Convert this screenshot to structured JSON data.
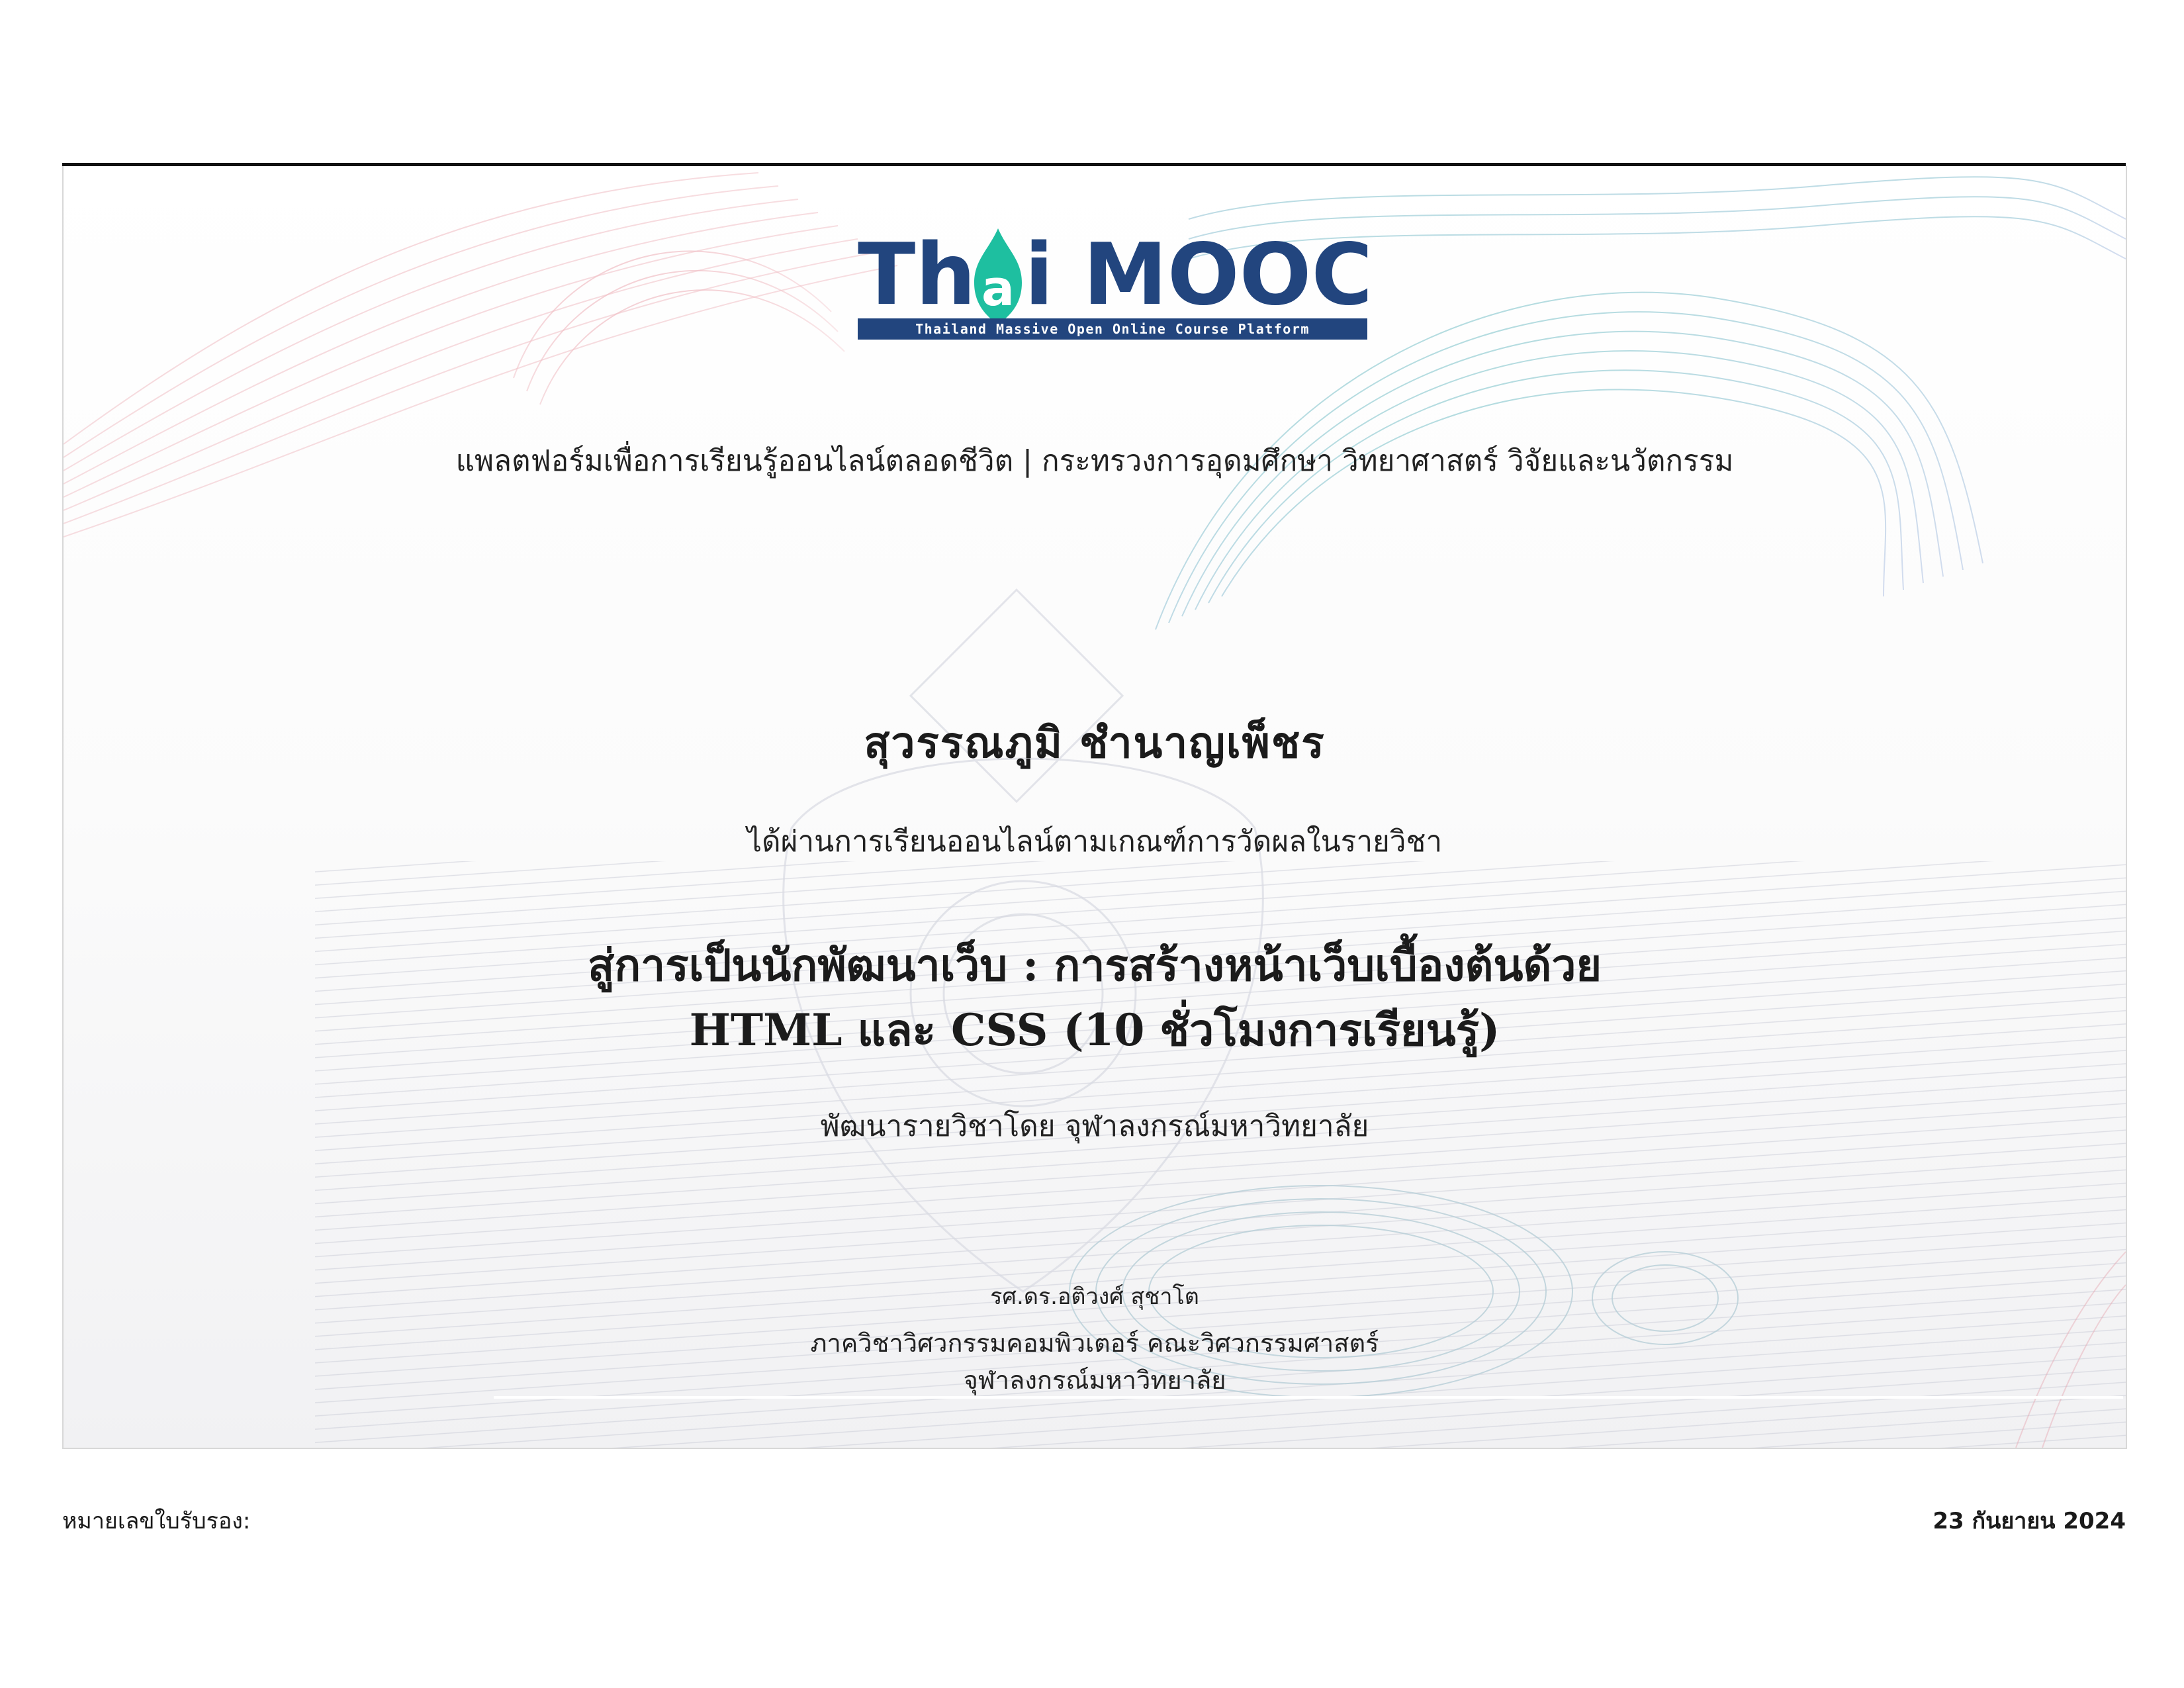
{
  "logo": {
    "wordmark_left": "Th",
    "wordmark_mid": "a",
    "wordmark_right": "i MOOC",
    "tagline": "Thailand Massive Open Online Course Platform",
    "colors": {
      "navy": "#22457e",
      "teal": "#1ebfa0"
    }
  },
  "certificate": {
    "subtitle": "แพลตฟอร์มเพื่อการเรียนรู้ออนไลน์ตลอดชีวิต | กระทรวงการอุดมศึกษา วิทยาศาสตร์ วิจัยและนวัตกรรม",
    "recipient_name": "สุวรรณภูมิ ชำนาญเพ็ชร",
    "passed_text": "ได้ผ่านการเรียนออนไลน์ตามเกณฑ์การวัดผลในรายวิชา",
    "course_title_line1": "สู่การเป็นนักพัฒนาเว็บ : การสร้างหน้าเว็บเบื้องต้นด้วย",
    "course_title_line2": "HTML และ CSS (10 ชั่วโมงการเรียนรู้)",
    "developed_by": "พัฒนารายวิชาโดย จุฬาลงกรณ์มหาวิทยาลัย",
    "signer_name": "รศ.ดร.อติวงศ์ สุชาโต",
    "signer_dept_line1": "ภาควิชาวิศวกรรมคอมพิวเตอร์ คณะวิศวกรรมศาสตร์",
    "signer_dept_line2": "จุฬาลงกรณ์มหาวิทยาลัย"
  },
  "footer": {
    "certificate_number_label": "หมายเลขใบรับรอง:",
    "date": "23 กันยายน 2024"
  }
}
